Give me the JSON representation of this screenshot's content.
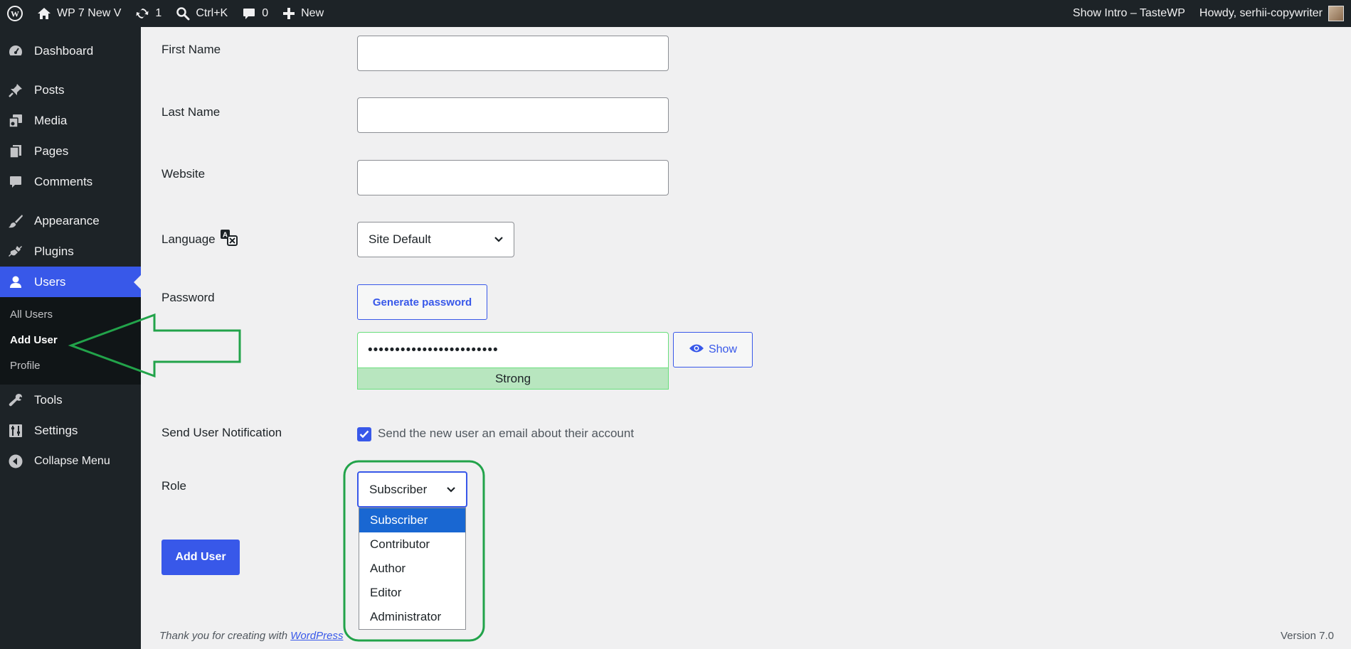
{
  "adminbar": {
    "site_name": "WP 7 New V",
    "updates_count": "1",
    "search_shortcut": "Ctrl+K",
    "comments_count": "0",
    "new_label": "New",
    "show_intro": "Show Intro – TasteWP",
    "howdy": "Howdy, serhii-copywriter"
  },
  "sidebar": {
    "items": [
      {
        "label": "Dashboard",
        "icon": "dashboard-icon"
      },
      {
        "label": "Posts",
        "icon": "pin-icon"
      },
      {
        "label": "Media",
        "icon": "media-icon"
      },
      {
        "label": "Pages",
        "icon": "pages-icon"
      },
      {
        "label": "Comments",
        "icon": "comment-icon"
      },
      {
        "label": "Appearance",
        "icon": "brush-icon"
      },
      {
        "label": "Plugins",
        "icon": "plug-icon"
      },
      {
        "label": "Users",
        "icon": "user-icon"
      },
      {
        "label": "Tools",
        "icon": "wrench-icon"
      },
      {
        "label": "Settings",
        "icon": "settings-icon"
      },
      {
        "label": "Collapse Menu",
        "icon": "collapse-icon"
      }
    ],
    "users_submenu": [
      "All Users",
      "Add User",
      "Profile"
    ]
  },
  "form": {
    "first_name_label": "First Name",
    "last_name_label": "Last Name",
    "website_label": "Website",
    "language_label": "Language",
    "language_value": "Site Default",
    "password_label": "Password",
    "generate_password": "Generate password",
    "password_value": "••••••••••••••••••••••••",
    "show_label": "Show",
    "strength": "Strong",
    "notification_label": "Send User Notification",
    "notification_text": "Send the new user an email about their account",
    "notification_checked": true,
    "role_label": "Role",
    "role_value": "Subscriber",
    "role_options": [
      "Subscriber",
      "Contributor",
      "Author",
      "Editor",
      "Administrator"
    ],
    "add_user_button": "Add User"
  },
  "footer": {
    "thanks_prefix": "Thank you for creating with ",
    "thanks_link": "WordPress",
    "version": "Version 7.0"
  },
  "colors": {
    "admin_dark": "#1d2327",
    "accent": "#3858e9",
    "annotation_green": "#22a34a",
    "strength_bg": "#b8e6bf"
  }
}
